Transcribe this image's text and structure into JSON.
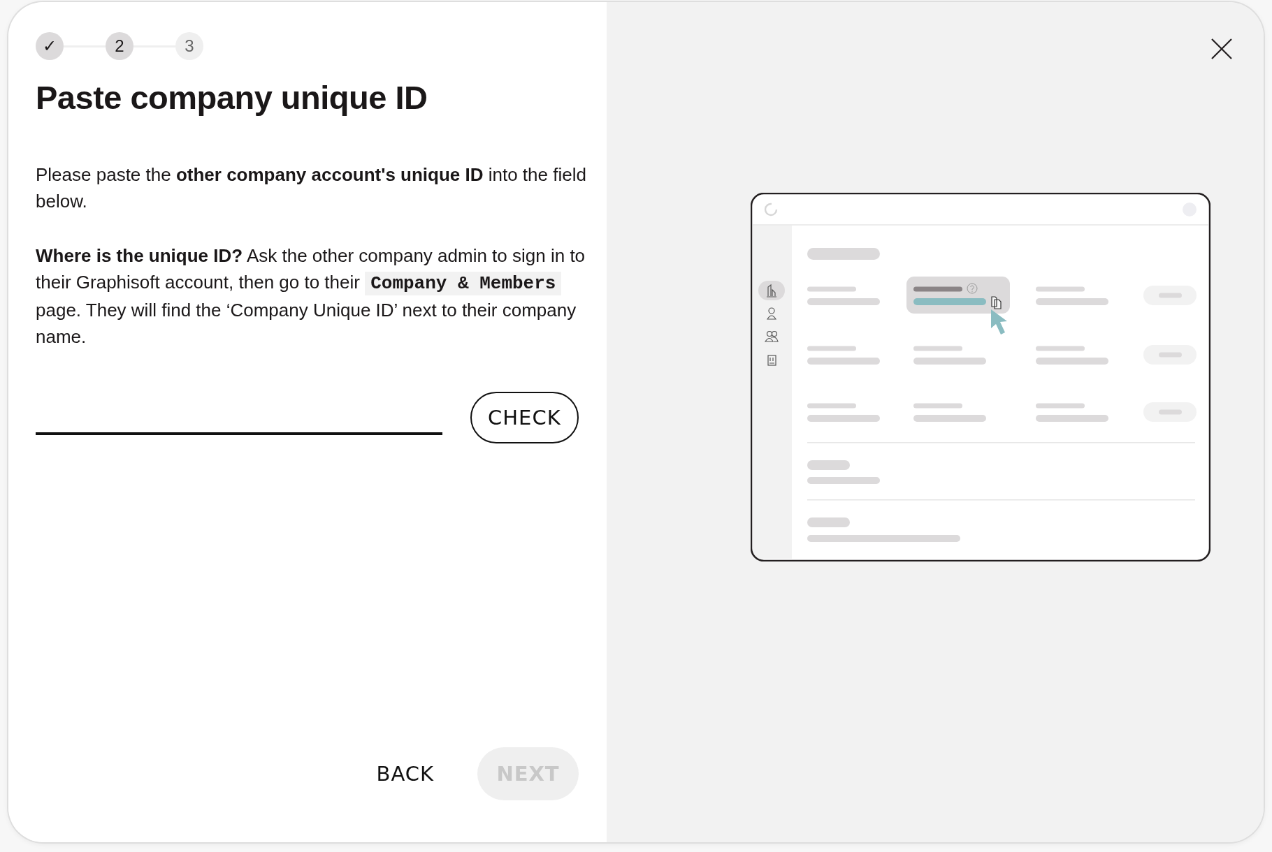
{
  "stepper": [
    {
      "label": "✓",
      "reached": true
    },
    {
      "label": "2",
      "reached": true
    },
    {
      "label": "3",
      "reached": false
    }
  ],
  "title": "Paste company unique ID",
  "paragraphs": [
    [
      {
        "kind": "text",
        "text": "Please paste the **other company account's unique ID** into the field below."
      }
    ],
    [
      {
        "kind": "text",
        "text": "**Where is the unique ID?** Ask the other company admin to sign in to their Graphisoft account, then go to their "
      },
      {
        "kind": "code",
        "text": "Company & Members"
      },
      {
        "kind": "text",
        "text": " page. They will find the ‘Company Unique ID’ next to their company name."
      }
    ]
  ],
  "check_button": {
    "label": "CHECK"
  },
  "back_button": {
    "label": "BACK"
  },
  "next_button": {
    "label": "NEXT",
    "disabled": true
  }
}
